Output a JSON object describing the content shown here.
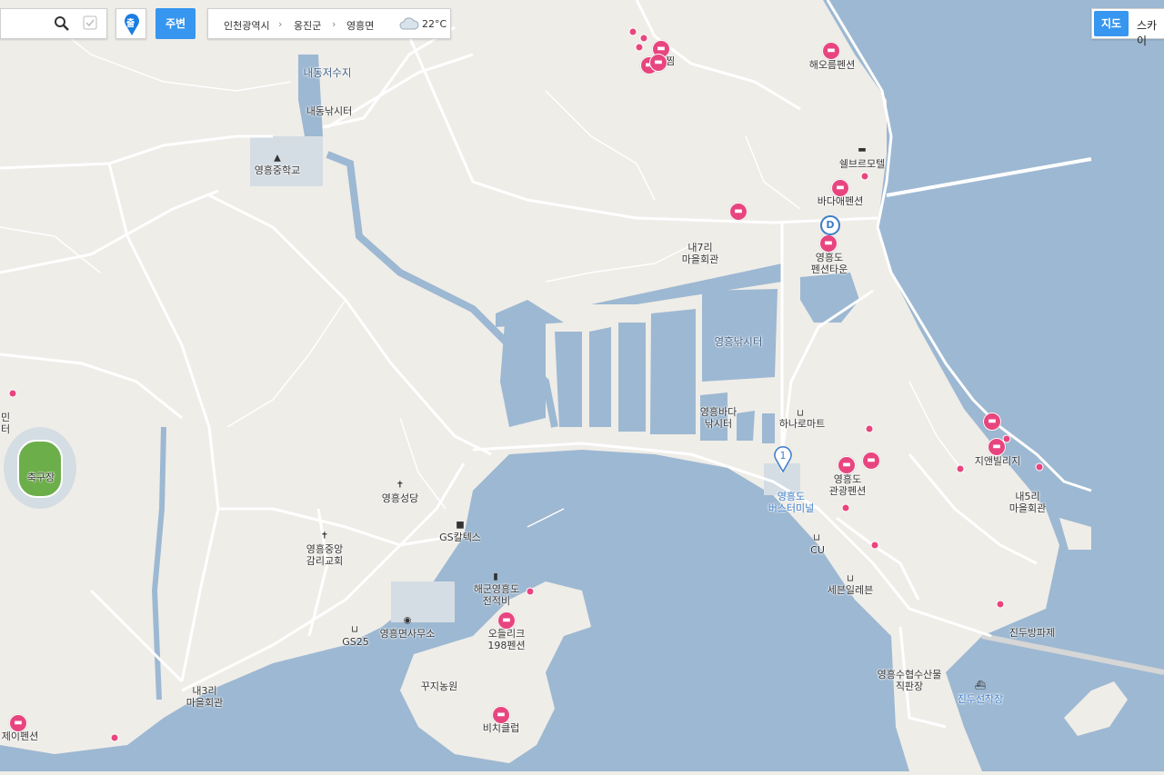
{
  "toolbar": {
    "around_label": "주변",
    "start_label": "출",
    "breadcrumb": [
      "인천광역시",
      "옹진군",
      "영흥면"
    ],
    "weather": "22°C",
    "map_types": [
      "지도",
      "스카이"
    ]
  },
  "markers": {
    "bus_number": "1",
    "d_label": "D"
  },
  "labels": {
    "l01": "내동저수지",
    "l02": "내동낚시터",
    "l03": "영흥중학교",
    "l04": "해오름펜션",
    "l05": "쉘브르모텔",
    "l06": "바다애펜션",
    "l07": "내7리\n마을회관",
    "l08": "영흥도\n펜션타운",
    "l09": "영흥낚시터",
    "l10": "영흥바다\n낚시터",
    "l11": "하나로마트",
    "l12": "지앤빌리지",
    "l13": "영흥도\n관광펜션",
    "l14": "영흥도\n버스터미널",
    "l15": "내5리\n마을회관",
    "l16": "CU",
    "l17": "세븐일레븐",
    "l18": "진두방파제",
    "l19": "영흥수협수산물\n직판장",
    "l20": "진두선착장",
    "l21": "영흥성당",
    "l22": "GS칼텍스",
    "l23": "영흥중앙\n감리교회",
    "l24": "해군영흥도\n전적비",
    "l25": "영흥면사무소",
    "l26": "GS25",
    "l27": "오들리크\n198펜션",
    "l28": "꾸지농원",
    "l29": "내3리\n마을회관",
    "l30": "비치클럽",
    "l31": "제이펜션",
    "l32": "축구장",
    "l33": "민\n터",
    "l34": "찜"
  }
}
